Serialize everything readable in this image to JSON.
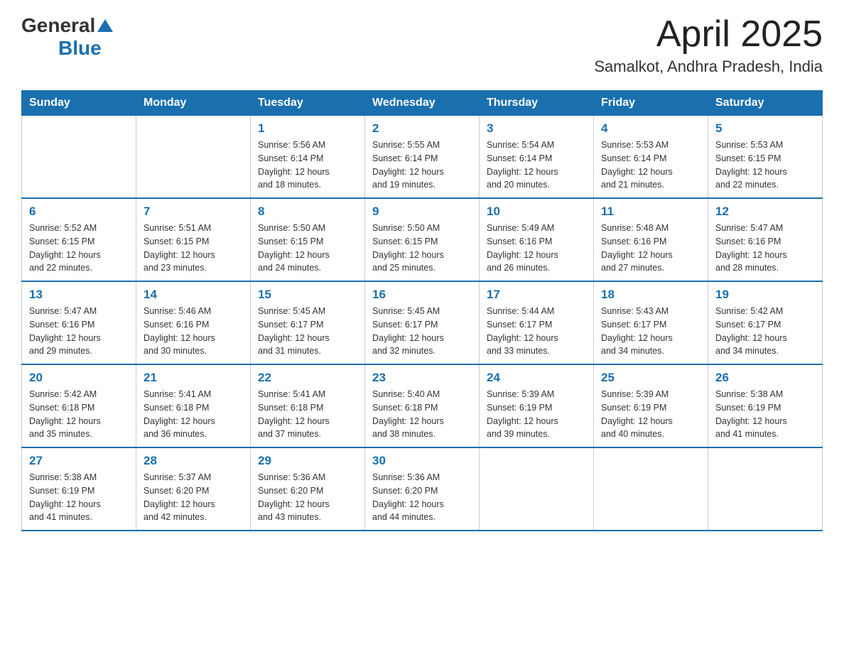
{
  "logo": {
    "general": "General",
    "blue": "Blue"
  },
  "title": {
    "month_year": "April 2025",
    "location": "Samalkot, Andhra Pradesh, India"
  },
  "calendar": {
    "headers": [
      "Sunday",
      "Monday",
      "Tuesday",
      "Wednesday",
      "Thursday",
      "Friday",
      "Saturday"
    ],
    "weeks": [
      [
        {
          "day": "",
          "info": ""
        },
        {
          "day": "",
          "info": ""
        },
        {
          "day": "1",
          "info": "Sunrise: 5:56 AM\nSunset: 6:14 PM\nDaylight: 12 hours\nand 18 minutes."
        },
        {
          "day": "2",
          "info": "Sunrise: 5:55 AM\nSunset: 6:14 PM\nDaylight: 12 hours\nand 19 minutes."
        },
        {
          "day": "3",
          "info": "Sunrise: 5:54 AM\nSunset: 6:14 PM\nDaylight: 12 hours\nand 20 minutes."
        },
        {
          "day": "4",
          "info": "Sunrise: 5:53 AM\nSunset: 6:14 PM\nDaylight: 12 hours\nand 21 minutes."
        },
        {
          "day": "5",
          "info": "Sunrise: 5:53 AM\nSunset: 6:15 PM\nDaylight: 12 hours\nand 22 minutes."
        }
      ],
      [
        {
          "day": "6",
          "info": "Sunrise: 5:52 AM\nSunset: 6:15 PM\nDaylight: 12 hours\nand 22 minutes."
        },
        {
          "day": "7",
          "info": "Sunrise: 5:51 AM\nSunset: 6:15 PM\nDaylight: 12 hours\nand 23 minutes."
        },
        {
          "day": "8",
          "info": "Sunrise: 5:50 AM\nSunset: 6:15 PM\nDaylight: 12 hours\nand 24 minutes."
        },
        {
          "day": "9",
          "info": "Sunrise: 5:50 AM\nSunset: 6:15 PM\nDaylight: 12 hours\nand 25 minutes."
        },
        {
          "day": "10",
          "info": "Sunrise: 5:49 AM\nSunset: 6:16 PM\nDaylight: 12 hours\nand 26 minutes."
        },
        {
          "day": "11",
          "info": "Sunrise: 5:48 AM\nSunset: 6:16 PM\nDaylight: 12 hours\nand 27 minutes."
        },
        {
          "day": "12",
          "info": "Sunrise: 5:47 AM\nSunset: 6:16 PM\nDaylight: 12 hours\nand 28 minutes."
        }
      ],
      [
        {
          "day": "13",
          "info": "Sunrise: 5:47 AM\nSunset: 6:16 PM\nDaylight: 12 hours\nand 29 minutes."
        },
        {
          "day": "14",
          "info": "Sunrise: 5:46 AM\nSunset: 6:16 PM\nDaylight: 12 hours\nand 30 minutes."
        },
        {
          "day": "15",
          "info": "Sunrise: 5:45 AM\nSunset: 6:17 PM\nDaylight: 12 hours\nand 31 minutes."
        },
        {
          "day": "16",
          "info": "Sunrise: 5:45 AM\nSunset: 6:17 PM\nDaylight: 12 hours\nand 32 minutes."
        },
        {
          "day": "17",
          "info": "Sunrise: 5:44 AM\nSunset: 6:17 PM\nDaylight: 12 hours\nand 33 minutes."
        },
        {
          "day": "18",
          "info": "Sunrise: 5:43 AM\nSunset: 6:17 PM\nDaylight: 12 hours\nand 34 minutes."
        },
        {
          "day": "19",
          "info": "Sunrise: 5:42 AM\nSunset: 6:17 PM\nDaylight: 12 hours\nand 34 minutes."
        }
      ],
      [
        {
          "day": "20",
          "info": "Sunrise: 5:42 AM\nSunset: 6:18 PM\nDaylight: 12 hours\nand 35 minutes."
        },
        {
          "day": "21",
          "info": "Sunrise: 5:41 AM\nSunset: 6:18 PM\nDaylight: 12 hours\nand 36 minutes."
        },
        {
          "day": "22",
          "info": "Sunrise: 5:41 AM\nSunset: 6:18 PM\nDaylight: 12 hours\nand 37 minutes."
        },
        {
          "day": "23",
          "info": "Sunrise: 5:40 AM\nSunset: 6:18 PM\nDaylight: 12 hours\nand 38 minutes."
        },
        {
          "day": "24",
          "info": "Sunrise: 5:39 AM\nSunset: 6:19 PM\nDaylight: 12 hours\nand 39 minutes."
        },
        {
          "day": "25",
          "info": "Sunrise: 5:39 AM\nSunset: 6:19 PM\nDaylight: 12 hours\nand 40 minutes."
        },
        {
          "day": "26",
          "info": "Sunrise: 5:38 AM\nSunset: 6:19 PM\nDaylight: 12 hours\nand 41 minutes."
        }
      ],
      [
        {
          "day": "27",
          "info": "Sunrise: 5:38 AM\nSunset: 6:19 PM\nDaylight: 12 hours\nand 41 minutes."
        },
        {
          "day": "28",
          "info": "Sunrise: 5:37 AM\nSunset: 6:20 PM\nDaylight: 12 hours\nand 42 minutes."
        },
        {
          "day": "29",
          "info": "Sunrise: 5:36 AM\nSunset: 6:20 PM\nDaylight: 12 hours\nand 43 minutes."
        },
        {
          "day": "30",
          "info": "Sunrise: 5:36 AM\nSunset: 6:20 PM\nDaylight: 12 hours\nand 44 minutes."
        },
        {
          "day": "",
          "info": ""
        },
        {
          "day": "",
          "info": ""
        },
        {
          "day": "",
          "info": ""
        }
      ]
    ]
  }
}
